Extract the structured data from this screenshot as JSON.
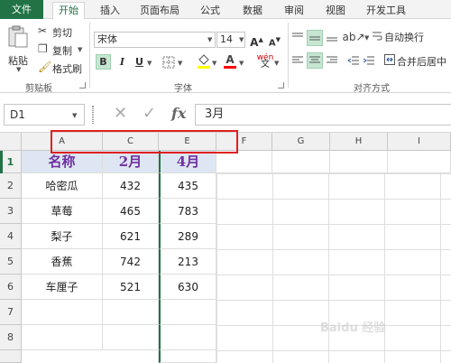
{
  "ribbon_tabs": [
    "文件",
    "开始",
    "插入",
    "页面布局",
    "公式",
    "数据",
    "审阅",
    "视图",
    "开发工具"
  ],
  "clipboard": {
    "paste_label": "粘贴",
    "cut_label": "剪切",
    "copy_label": "复制",
    "format_painter_label": "格式刷",
    "group_label": "剪贴板"
  },
  "font": {
    "family_value": "宋体",
    "size_value": "14",
    "grow_label": "A",
    "shrink_label": "A",
    "bold_label": "B",
    "italic_label": "I",
    "underline_label": "U",
    "font_color_label": "A",
    "phonetic_label": "wén",
    "group_label": "字体",
    "accent_color": "#217346",
    "font_color_bar": "#ff0000",
    "fill_color_bar": "#ffff00"
  },
  "alignment": {
    "wrap_text_label": "自动换行",
    "merge_center_label": "合并后居中",
    "group_label": "对齐方式"
  },
  "formula_bar": {
    "name_box_value": "D1",
    "cancel_icon": "cancel-icon",
    "enter_icon": "check-icon",
    "fx_label": "fx",
    "formula_value": "3月"
  },
  "columns": [
    "A",
    "C",
    "E",
    "F",
    "G",
    "H",
    "I"
  ],
  "rows": [
    "1",
    "2",
    "3",
    "4",
    "5",
    "6",
    "7",
    "8"
  ],
  "table": {
    "headers": [
      "名称",
      "2月",
      "4月"
    ],
    "rows": [
      [
        "哈密瓜",
        "432",
        "435"
      ],
      [
        "草莓",
        "465",
        "783"
      ],
      [
        "梨子",
        "621",
        "289"
      ],
      [
        "香蕉",
        "742",
        "213"
      ],
      [
        "车厘子",
        "521",
        "630"
      ]
    ]
  },
  "watermark": "Baidu 经验"
}
